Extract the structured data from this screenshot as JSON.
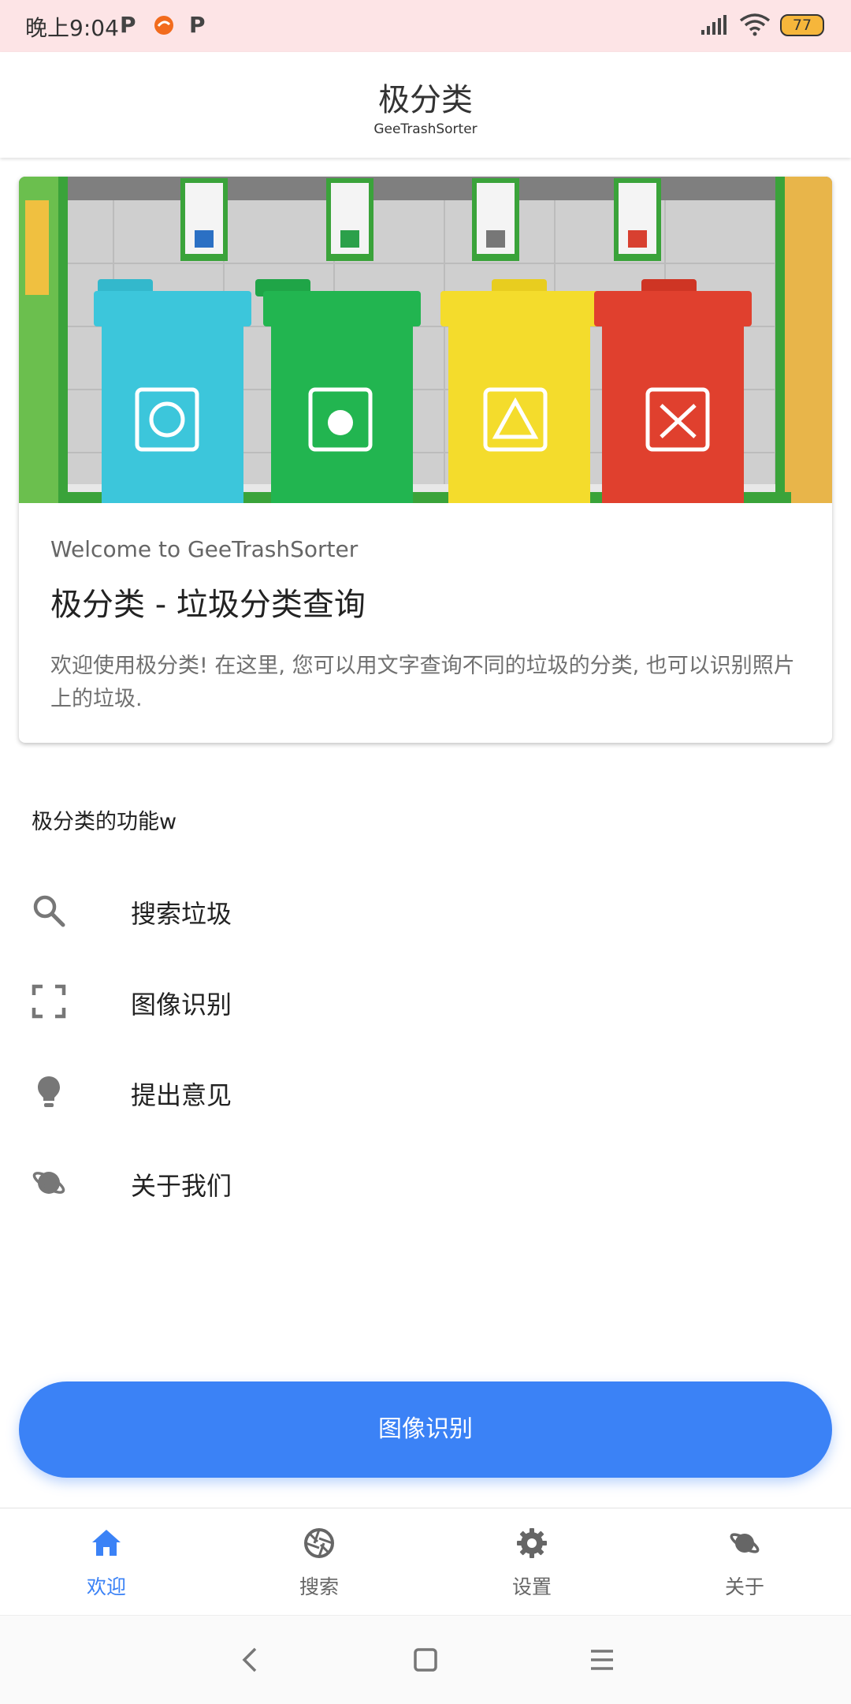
{
  "status_bar": {
    "time": "晚上9:04",
    "notification_p1": "P",
    "notification_p2": "P",
    "battery": "77"
  },
  "app_bar": {
    "title": "极分类",
    "subtitle": "GeeTrashSorter"
  },
  "card": {
    "overline": "Welcome to GeeTrashSorter",
    "title": "极分类 - 垃圾分类查询",
    "body": "欢迎使用极分类! 在这里, 您可以用文字查询不同的垃圾的分类, 也可以识别照片上的垃圾."
  },
  "features": {
    "heading": "极分类的功能w",
    "items": [
      {
        "label": "搜索垃圾",
        "icon": "search-icon"
      },
      {
        "label": "图像识别",
        "icon": "scan-icon"
      },
      {
        "label": "提出意见",
        "icon": "lightbulb-icon"
      },
      {
        "label": "关于我们",
        "icon": "planet-icon"
      }
    ]
  },
  "primary_button": {
    "label": "图像识别"
  },
  "bottom_nav": {
    "items": [
      {
        "label": "欢迎",
        "icon": "home-icon",
        "active": true
      },
      {
        "label": "搜索",
        "icon": "camera-shutter-icon",
        "active": false
      },
      {
        "label": "设置",
        "icon": "gear-icon",
        "active": false
      },
      {
        "label": "关于",
        "icon": "planet-icon",
        "active": false
      }
    ]
  },
  "colors": {
    "accent": "#3b82f6",
    "status_bar_bg": "#fde4e6",
    "bin_blue": "#3cc6db",
    "bin_green": "#22b550",
    "bin_yellow": "#f4dc2c",
    "bin_red": "#e0402e"
  }
}
